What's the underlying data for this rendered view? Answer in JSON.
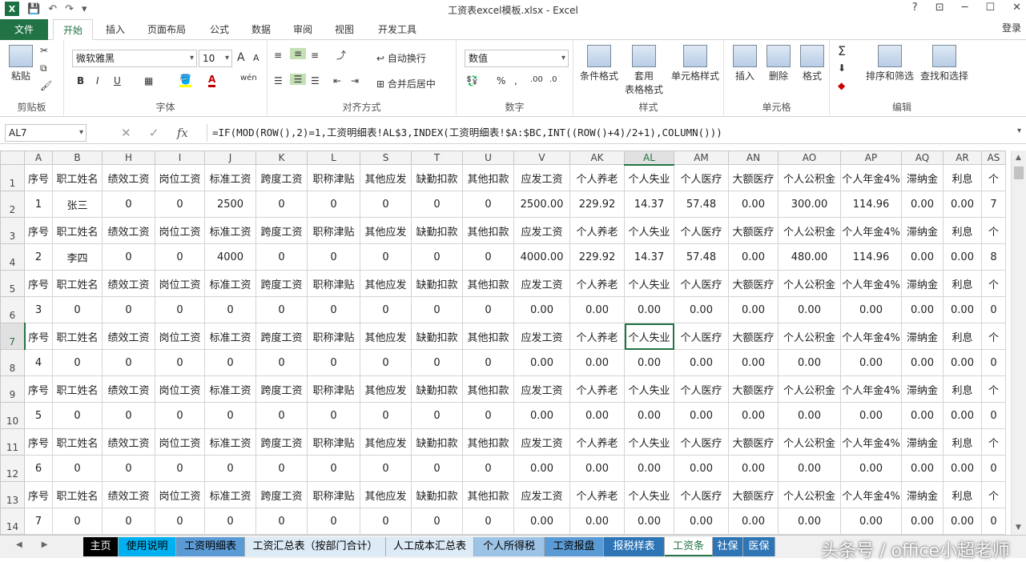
{
  "window": {
    "title": "工资表excel模板.xlsx - Excel",
    "login": "登录",
    "controls": [
      "?",
      "⊡",
      "─",
      "☐",
      "✕"
    ]
  },
  "ribbon_tabs": [
    "文件",
    "开始",
    "插入",
    "页面布局",
    "公式",
    "数据",
    "审阅",
    "视图",
    "开发工具"
  ],
  "ribbon": {
    "clipboard": {
      "label": "剪贴板",
      "paste": "粘贴"
    },
    "font": {
      "label": "字体",
      "name": "微软雅黑",
      "size": "10",
      "bold": "B",
      "italic": "I",
      "underline": "U",
      "wen": "wén",
      "grow": "A",
      "shrink": "A"
    },
    "align": {
      "label": "对齐方式",
      "wrap": "自动换行",
      "merge": "合并后居中"
    },
    "number": {
      "label": "数字",
      "format": "数值"
    },
    "styles": {
      "label": "样式",
      "cond": "条件格式",
      "table1": "套用",
      "table2": "表格格式",
      "cell": "单元格样式"
    },
    "cells": {
      "label": "单元格",
      "insert": "插入",
      "delete": "删除",
      "format": "格式"
    },
    "edit": {
      "label": "编辑",
      "sort": "排序和筛选",
      "find": "查找和选择"
    }
  },
  "formula_bar": {
    "name_box": "AL7",
    "fx": "fx",
    "formula": "=IF(MOD(ROW(),2)=1,工资明细表!AL$3,INDEX(工资明细表!$A:$BC,INT((ROW()+4)/2+1),COLUMN()))"
  },
  "grid": {
    "columns": [
      "A",
      "B",
      "H",
      "I",
      "J",
      "K",
      "L",
      "S",
      "T",
      "U",
      "V",
      "AK",
      "AL",
      "AM",
      "AN",
      "AO",
      "AP",
      "AQ",
      "AR",
      "AS"
    ],
    "selected_column": "AL",
    "selected_row": "7",
    "header_row": [
      "序号",
      "职工姓名",
      "绩效工资",
      "岗位工资",
      "标准工资",
      "跨度工资",
      "职称津贴",
      "其他应发",
      "缺勤扣款",
      "其他扣款",
      "应发工资",
      "个人养老",
      "个人失业",
      "个人医疗",
      "大额医疗",
      "个人公积金",
      "个人年金4%",
      "滞纳金",
      "利息",
      "个"
    ],
    "rows": [
      {
        "n": "1",
        "cells": [
          "序号",
          "职工姓名",
          "绩效工资",
          "岗位工资",
          "标准工资",
          "跨度工资",
          "职称津贴",
          "其他应发",
          "缺勤扣款",
          "其他扣款",
          "应发工资",
          "个人养老",
          "个人失业",
          "个人医疗",
          "大额医疗",
          "个人公积金",
          "个人年金4%",
          "滞纳金",
          "利息",
          "个"
        ]
      },
      {
        "n": "2",
        "cells": [
          "1",
          "张三",
          "0",
          "0",
          "2500",
          "0",
          "0",
          "0",
          "0",
          "0",
          "2500.00",
          "229.92",
          "14.37",
          "57.48",
          "0.00",
          "300.00",
          "114.96",
          "0.00",
          "0.00",
          "7"
        ]
      },
      {
        "n": "3",
        "cells": [
          "序号",
          "职工姓名",
          "绩效工资",
          "岗位工资",
          "标准工资",
          "跨度工资",
          "职称津贴",
          "其他应发",
          "缺勤扣款",
          "其他扣款",
          "应发工资",
          "个人养老",
          "个人失业",
          "个人医疗",
          "大额医疗",
          "个人公积金",
          "个人年金4%",
          "滞纳金",
          "利息",
          "个"
        ]
      },
      {
        "n": "4",
        "cells": [
          "2",
          "李四",
          "0",
          "0",
          "4000",
          "0",
          "0",
          "0",
          "0",
          "0",
          "4000.00",
          "229.92",
          "14.37",
          "57.48",
          "0.00",
          "480.00",
          "114.96",
          "0.00",
          "0.00",
          "8"
        ]
      },
      {
        "n": "5",
        "cells": [
          "序号",
          "职工姓名",
          "绩效工资",
          "岗位工资",
          "标准工资",
          "跨度工资",
          "职称津贴",
          "其他应发",
          "缺勤扣款",
          "其他扣款",
          "应发工资",
          "个人养老",
          "个人失业",
          "个人医疗",
          "大额医疗",
          "个人公积金",
          "个人年金4%",
          "滞纳金",
          "利息",
          "个"
        ]
      },
      {
        "n": "6",
        "cells": [
          "3",
          "0",
          "0",
          "0",
          "0",
          "0",
          "0",
          "0",
          "0",
          "0",
          "0.00",
          "0.00",
          "0.00",
          "0.00",
          "0.00",
          "0.00",
          "0.00",
          "0.00",
          "0.00",
          "0"
        ]
      },
      {
        "n": "7",
        "cells": [
          "序号",
          "职工姓名",
          "绩效工资",
          "岗位工资",
          "标准工资",
          "跨度工资",
          "职称津贴",
          "其他应发",
          "缺勤扣款",
          "其他扣款",
          "应发工资",
          "个人养老",
          "个人失业",
          "个人医疗",
          "大额医疗",
          "个人公积金",
          "个人年金4%",
          "滞纳金",
          "利息",
          "个"
        ]
      },
      {
        "n": "8",
        "cells": [
          "4",
          "0",
          "0",
          "0",
          "0",
          "0",
          "0",
          "0",
          "0",
          "0",
          "0.00",
          "0.00",
          "0.00",
          "0.00",
          "0.00",
          "0.00",
          "0.00",
          "0.00",
          "0.00",
          "0"
        ]
      },
      {
        "n": "9",
        "cells": [
          "序号",
          "职工姓名",
          "绩效工资",
          "岗位工资",
          "标准工资",
          "跨度工资",
          "职称津贴",
          "其他应发",
          "缺勤扣款",
          "其他扣款",
          "应发工资",
          "个人养老",
          "个人失业",
          "个人医疗",
          "大额医疗",
          "个人公积金",
          "个人年金4%",
          "滞纳金",
          "利息",
          "个"
        ]
      },
      {
        "n": "10",
        "cells": [
          "5",
          "0",
          "0",
          "0",
          "0",
          "0",
          "0",
          "0",
          "0",
          "0",
          "0.00",
          "0.00",
          "0.00",
          "0.00",
          "0.00",
          "0.00",
          "0.00",
          "0.00",
          "0.00",
          "0"
        ]
      },
      {
        "n": "11",
        "cells": [
          "序号",
          "职工姓名",
          "绩效工资",
          "岗位工资",
          "标准工资",
          "跨度工资",
          "职称津贴",
          "其他应发",
          "缺勤扣款",
          "其他扣款",
          "应发工资",
          "个人养老",
          "个人失业",
          "个人医疗",
          "大额医疗",
          "个人公积金",
          "个人年金4%",
          "滞纳金",
          "利息",
          "个"
        ]
      },
      {
        "n": "12",
        "cells": [
          "6",
          "0",
          "0",
          "0",
          "0",
          "0",
          "0",
          "0",
          "0",
          "0",
          "0.00",
          "0.00",
          "0.00",
          "0.00",
          "0.00",
          "0.00",
          "0.00",
          "0.00",
          "0.00",
          "0"
        ]
      },
      {
        "n": "13",
        "cells": [
          "序号",
          "职工姓名",
          "绩效工资",
          "岗位工资",
          "标准工资",
          "跨度工资",
          "职称津贴",
          "其他应发",
          "缺勤扣款",
          "其他扣款",
          "应发工资",
          "个人养老",
          "个人失业",
          "个人医疗",
          "大额医疗",
          "个人公积金",
          "个人年金4%",
          "滞纳金",
          "利息",
          "个"
        ]
      },
      {
        "n": "14",
        "cells": [
          "7",
          "0",
          "0",
          "0",
          "0",
          "0",
          "0",
          "0",
          "0",
          "0",
          "0.00",
          "0.00",
          "0.00",
          "0.00",
          "0.00",
          "0.00",
          "0.00",
          "0.00",
          "0.00",
          "0"
        ]
      }
    ]
  },
  "sheet_tabs": [
    {
      "label": "主页",
      "color": "#000000",
      "text": "#ffffff"
    },
    {
      "label": "使用说明",
      "color": "#00b0f0",
      "text": "#000000"
    },
    {
      "label": "工资明细表",
      "color": "#5b9bd5",
      "text": "#000000"
    },
    {
      "label": "工资汇总表（按部门合计）",
      "color": "#ddebf7",
      "text": "#000000"
    },
    {
      "label": "人工成本汇总表",
      "color": "#ddebf7",
      "text": "#000000"
    },
    {
      "label": "个人所得税",
      "color": "#9dc3e6",
      "text": "#000000"
    },
    {
      "label": "工资报盘",
      "color": "#5b9bd5",
      "text": "#000000"
    },
    {
      "label": "报税样表",
      "color": "#2e75b6",
      "text": "#ffffff"
    },
    {
      "label": "工资条",
      "color": "#ffffff",
      "text": "#217346",
      "active": true
    },
    {
      "label": "社保",
      "color": "#2e75b6",
      "text": "#ffffff"
    },
    {
      "label": "医保",
      "color": "#2e75b6",
      "text": "#ffffff"
    }
  ],
  "watermark": "头条号 / office小超老师"
}
